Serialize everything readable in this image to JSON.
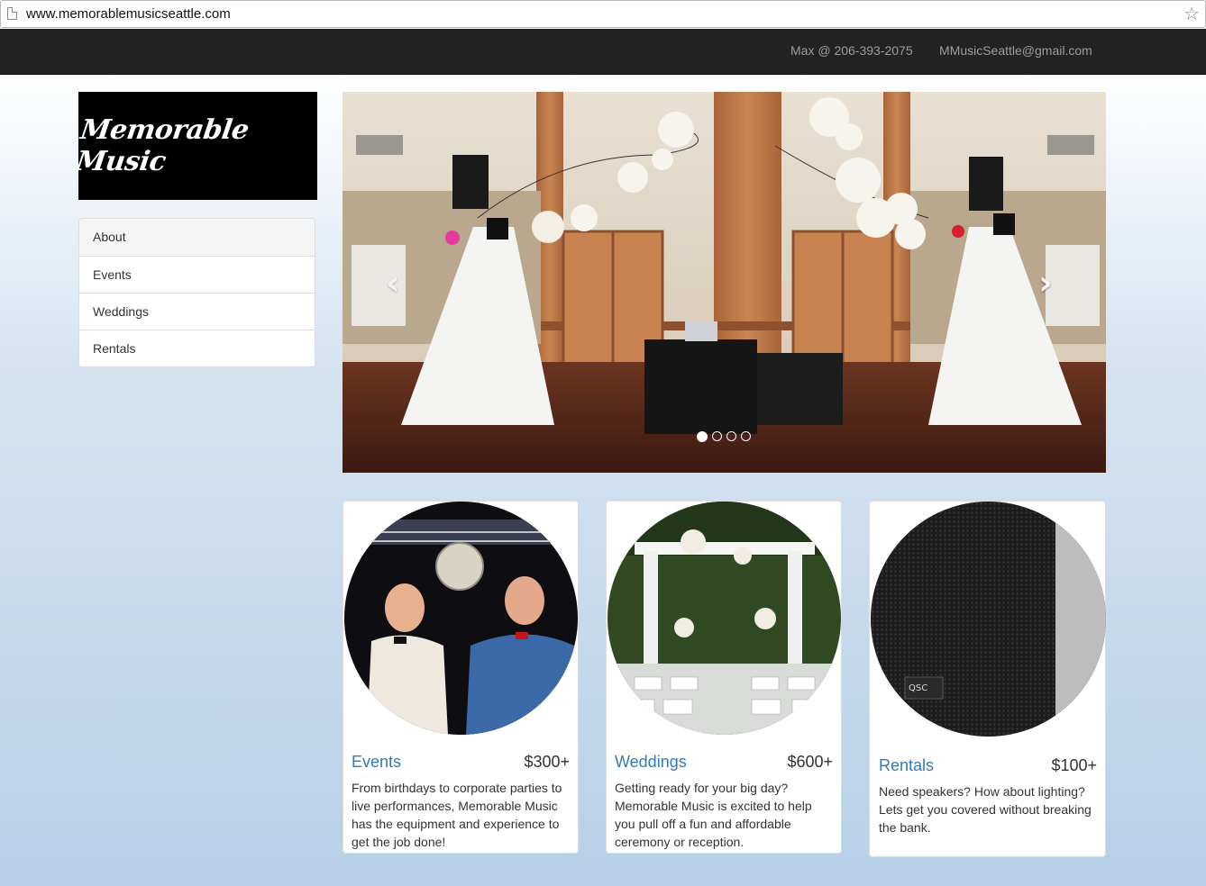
{
  "browser": {
    "url": "www.memorablemusicseattle.com"
  },
  "header": {
    "phone": "Max @ 206-393-2075",
    "email": "MMusicSeattle@gmail.com"
  },
  "brand": {
    "logo_text": "Memorable Music"
  },
  "sidebar": {
    "items": [
      {
        "label": "About",
        "active": true
      },
      {
        "label": "Events",
        "active": false
      },
      {
        "label": "Weddings",
        "active": false
      },
      {
        "label": "Rentals",
        "active": false
      }
    ]
  },
  "carousel": {
    "slide_count": 4,
    "active_slide": 0,
    "prev_glyph": "‹",
    "next_glyph": "›"
  },
  "cards": [
    {
      "title": "Events",
      "price": "$300+",
      "description": "From birthdays to corporate parties to live performances, Memorable Music has the equipment and experience to get the job done!"
    },
    {
      "title": "Weddings",
      "price": "$600+",
      "description": "Getting ready for your big day? Memorable Music is excited to help you pull off a fun and affordable ceremony or reception."
    },
    {
      "title": "Rentals",
      "price": "$100+",
      "description": "Need speakers? How about lighting? Lets get you covered without breaking the bank."
    }
  ],
  "colors": {
    "navbar": "#222222",
    "link": "#337ab7",
    "logo_bg": "#000000"
  }
}
